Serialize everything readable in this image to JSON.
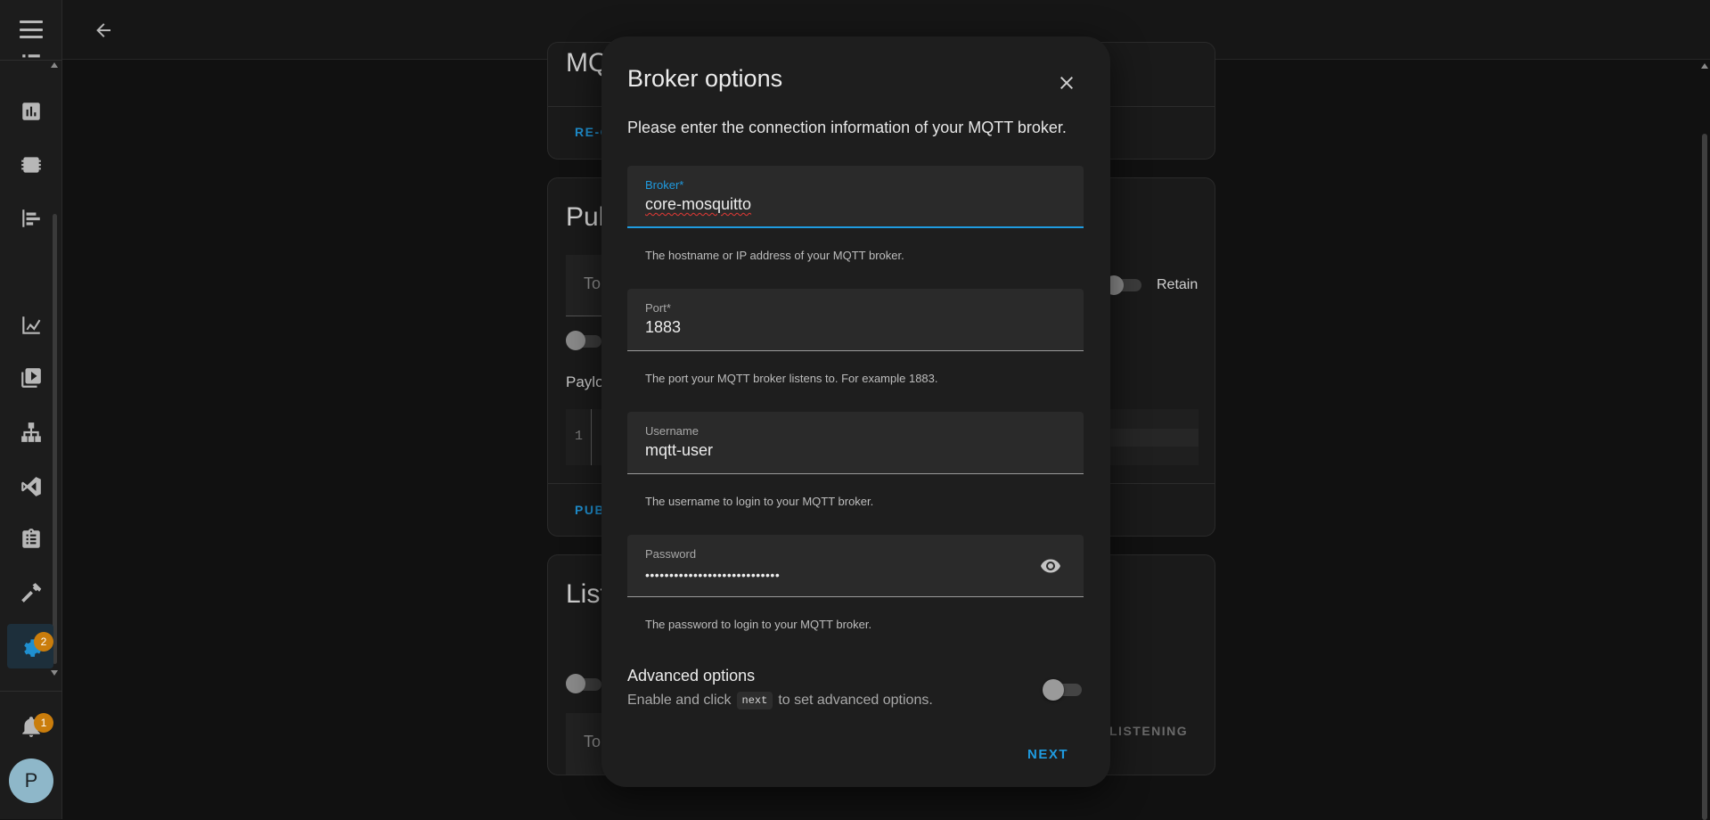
{
  "sidebar": {
    "settings_badge": "2",
    "notifications_badge": "1",
    "avatar_initial": "P"
  },
  "background": {
    "card1_heading": "MQ",
    "card1_action": "RE-C",
    "card2_heading": "Pub",
    "card2_topic_placeholder": "To",
    "card2_retain": "Retain",
    "card2_payload": "Paylo",
    "card2_line_number": "1",
    "card2_action": "PUB",
    "card3_heading": "List",
    "card3_topic_placeholder": "To",
    "card3_action": "LISTENING"
  },
  "dialog": {
    "title": "Broker options",
    "description": "Please enter the connection information of your MQTT broker.",
    "fields": [
      {
        "label": "Broker*",
        "value": "core-mosquitto",
        "helper": "The hostname or IP address of your MQTT broker."
      },
      {
        "label": "Port*",
        "value": "1883",
        "helper": "The port your MQTT broker listens to. For example 1883."
      },
      {
        "label": "Username",
        "value": "mqtt-user",
        "helper": "The username to login to your MQTT broker."
      },
      {
        "label": "Password",
        "value": "••••••••••••••••••••••••••••",
        "helper": "The password to login to your MQTT broker."
      }
    ],
    "advanced": {
      "title": "Advanced options",
      "desc_before": "Enable and click",
      "code": "next",
      "desc_after": "to set advanced options.",
      "enabled": false
    },
    "next_label": "NEXT"
  },
  "colors": {
    "accent": "#1f9be0",
    "badge": "#ca7d0c",
    "dialog_bg": "#1e1e1e",
    "page_bg": "#111111"
  }
}
